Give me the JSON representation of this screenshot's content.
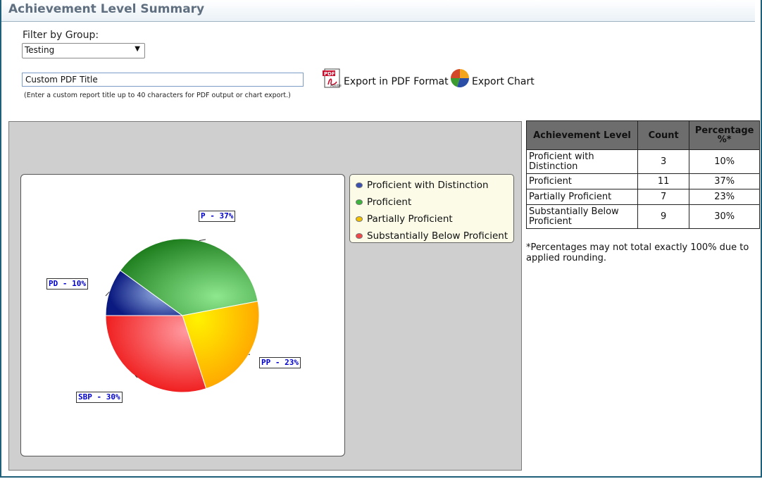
{
  "header": {
    "title": "Achievement Level Summary"
  },
  "filter": {
    "label": "Filter by Group:",
    "selected": "Testing"
  },
  "pdf_title": {
    "value": "Custom PDF Title",
    "hint": "(Enter a custom report title up to 40 characters for PDF output or chart export.)"
  },
  "exports": {
    "pdf_label": "Export in PDF Format",
    "chart_label": "Export Chart"
  },
  "legend": [
    {
      "label": "Proficient with Distinction",
      "color": "#3a4fb0"
    },
    {
      "label": "Proficient",
      "color": "#3cb53c"
    },
    {
      "label": "Partially Proficient",
      "color": "#f2c200"
    },
    {
      "label": "Substantially Below Proficient",
      "color": "#f04848"
    }
  ],
  "chart_data": {
    "type": "pie",
    "slices": [
      {
        "label": "PD - 10%",
        "value": 10,
        "color": "#0a1f8a"
      },
      {
        "label": "P - 37%",
        "value": 37,
        "color": "#2c8f2c"
      },
      {
        "label": "PP - 23%",
        "value": 23,
        "color": "#f2b800"
      },
      {
        "label": "SBP - 30%",
        "value": 30,
        "color": "#f02020"
      }
    ]
  },
  "table": {
    "headers": [
      "Achievement Level",
      "Count",
      "Percentage %*"
    ],
    "rows": [
      {
        "level": "Proficient with Distinction",
        "count": "3",
        "pct": "10%"
      },
      {
        "level": "Proficient",
        "count": "11",
        "pct": "37%"
      },
      {
        "level": "Partially Proficient",
        "count": "7",
        "pct": "23%"
      },
      {
        "level": "Substantially Below Proficient",
        "count": "9",
        "pct": "30%"
      }
    ],
    "footnote": "*Percentages may not total exactly 100% due to applied rounding."
  }
}
